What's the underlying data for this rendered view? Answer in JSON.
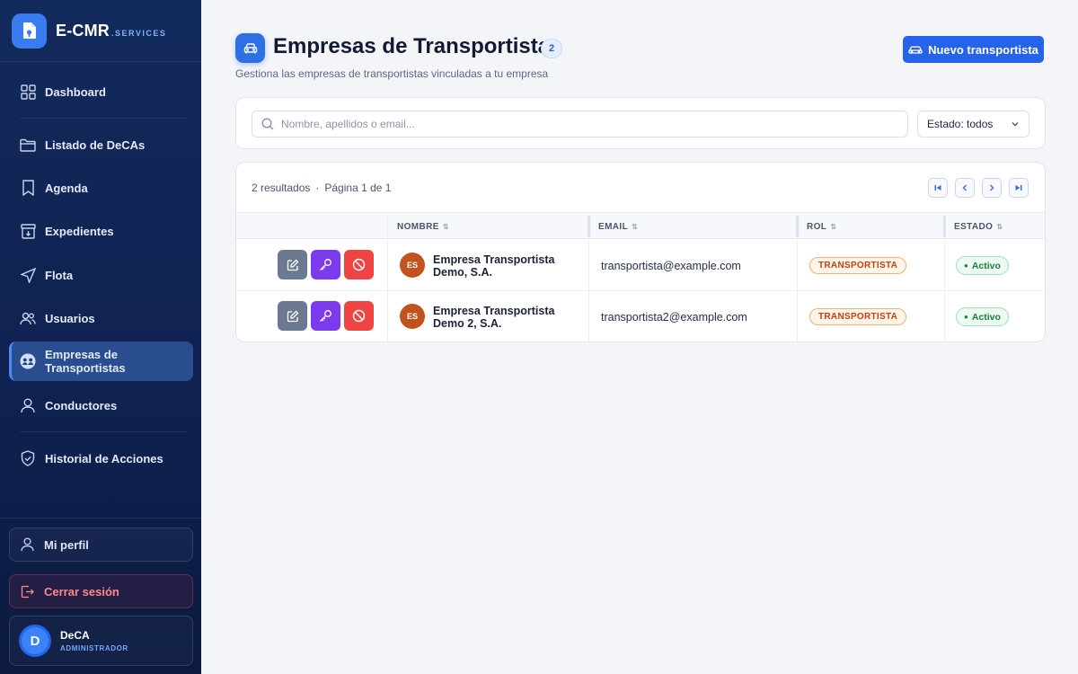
{
  "brand": {
    "name": "E-CMR",
    "suffix": ".SERVICES"
  },
  "sidebar": {
    "items": [
      {
        "label": "Dashboard",
        "icon": "grid-icon"
      },
      {
        "label": "Listado de DeCAs",
        "icon": "folder-icon"
      },
      {
        "label": "Agenda",
        "icon": "bookmark-icon"
      },
      {
        "label": "Expedientes",
        "icon": "archive-icon"
      },
      {
        "label": "Flota",
        "icon": "navigation-icon"
      },
      {
        "label": "Usuarios",
        "icon": "users-icon"
      },
      {
        "label": "Empresas de Transportistas",
        "icon": "companies-icon",
        "active": true
      },
      {
        "label": "Conductores",
        "icon": "user-icon"
      },
      {
        "label": "Historial de Acciones",
        "icon": "shield-icon"
      }
    ],
    "profile_label": "Mi perfil",
    "logout_label": "Cerrar sesión",
    "user": {
      "initial": "D",
      "name": "DeCA",
      "role": "ADMINISTRADOR"
    }
  },
  "header": {
    "title": "Empresas de Transportistas",
    "count": "2",
    "subtitle": "Gestiona las empresas de transportistas vinculadas a tu empresa",
    "new_button": "Nuevo transportista"
  },
  "filters": {
    "search_placeholder": "Nombre, apellidos o email...",
    "state_select": "Estado: todos"
  },
  "table": {
    "results": "2 resultados",
    "page_info": "Página 1 de 1",
    "columns": {
      "nombre": "NOMBRE",
      "email": "EMAIL",
      "rol": "ROL",
      "estado": "ESTADO"
    },
    "rows": [
      {
        "initials": "ES",
        "name": "Empresa Transportista Demo, S.A.",
        "email": "transportista@example.com",
        "role": "TRANSPORTISTA",
        "status": "Activo"
      },
      {
        "initials": "ES",
        "name": "Empresa Transportista Demo 2, S.A.",
        "email": "transportista2@example.com",
        "role": "TRANSPORTISTA",
        "status": "Activo"
      }
    ]
  },
  "colors": {
    "accent": "#2563eb",
    "sidebar_bg": "#102452",
    "edit": "#6b7a90",
    "key": "#7c3aed",
    "block": "#ef4444",
    "role": "#c2410c",
    "status": "#16803d"
  }
}
